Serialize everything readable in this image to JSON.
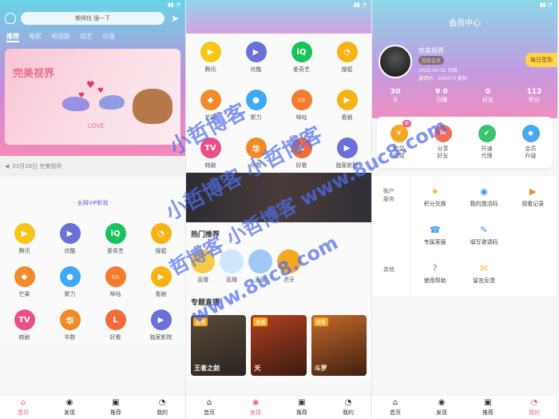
{
  "panel1": {
    "search_placeholder": "懒得找 搜一下",
    "tabs": [
      "推荐",
      "电影",
      "电视剧",
      "综艺",
      "动漫"
    ],
    "banner_title": "完美视界",
    "banner_love": "LOVE",
    "notice": "03月26日 完美视界",
    "vip_title": "· 全网VIP影视 ·",
    "grid": [
      {
        "label": "腾讯",
        "color": "#f5c518",
        "glyph": "▶"
      },
      {
        "label": "优酷",
        "color": "#6b6fd8",
        "glyph": "▶"
      },
      {
        "label": "爱奇艺",
        "color": "#19c35c",
        "glyph": "iQ"
      },
      {
        "label": "搜狐",
        "color": "#f5b316",
        "glyph": "◔"
      },
      {
        "label": "芒果",
        "color": "#f28b2b",
        "glyph": "◆"
      },
      {
        "label": "聚力",
        "color": "#3fa9f5",
        "glyph": "●"
      },
      {
        "label": "咪咕",
        "color": "#f57c2e",
        "glyph": "▭"
      },
      {
        "label": "看剧",
        "color": "#f5b316",
        "glyph": "▶"
      },
      {
        "label": "韩剧",
        "color": "#e94f8a",
        "glyph": "TV"
      },
      {
        "label": "华数",
        "color": "#f08a24",
        "glyph": "华"
      },
      {
        "label": "好看",
        "color": "#f26b3a",
        "glyph": "L"
      },
      {
        "label": "独家影院",
        "color": "#6b6fd8",
        "glyph": "▶"
      }
    ]
  },
  "panel2": {
    "grid": [
      {
        "label": "腾讯",
        "color": "#f5c518",
        "glyph": "▶"
      },
      {
        "label": "优酷",
        "color": "#6b6fd8",
        "glyph": "▶"
      },
      {
        "label": "爱奇艺",
        "color": "#19c35c",
        "glyph": "iQ"
      },
      {
        "label": "搜狐",
        "color": "#f5b316",
        "glyph": "◔"
      },
      {
        "label": "芒果",
        "color": "#f28b2b",
        "glyph": "◆"
      },
      {
        "label": "聚力",
        "color": "#3fa9f5",
        "glyph": "●"
      },
      {
        "label": "咪咕",
        "color": "#f57c2e",
        "glyph": "▭"
      },
      {
        "label": "看剧",
        "color": "#f5b316",
        "glyph": "▶"
      },
      {
        "label": "韩剧",
        "color": "#e94f8a",
        "glyph": "TV"
      },
      {
        "label": "华数",
        "color": "#f08a24",
        "glyph": "华"
      },
      {
        "label": "好看",
        "color": "#f26b3a",
        "glyph": "L"
      },
      {
        "label": "独家影院",
        "color": "#6b6fd8",
        "glyph": "▶"
      }
    ],
    "live_title": "热门推荐",
    "live_items": [
      "直播",
      "直播",
      "直播",
      "虎牙"
    ],
    "topic_title": "专题直播",
    "cards": [
      {
        "tag": "直播",
        "title": "王者之剑"
      },
      {
        "tag": "直播",
        "title": "天"
      },
      {
        "tag": "直播",
        "title": "斗罗"
      }
    ],
    "other": "其他"
  },
  "panel3": {
    "title": "会员中心",
    "username": "完美视界",
    "vip_badge": "超级会员",
    "meta_line1": "2020-04-02 到期",
    "meta_line2": "邀请码：309270 复制",
    "sign_button": "每日签到",
    "stats": [
      {
        "value": "30",
        "label": "天"
      },
      {
        "value": "¥ 0",
        "label": "已赚"
      },
      {
        "value": "0",
        "label": "好友"
      },
      {
        "value": "112",
        "label": "积分"
      }
    ],
    "new_tag": "新",
    "actions": [
      {
        "label": "收益\n提现",
        "color": "#f5a623",
        "glyph": "¥"
      },
      {
        "label": "分享\n好友",
        "color": "#f26b5a",
        "glyph": "✉"
      },
      {
        "label": "开通\n代理",
        "color": "#3cc46b",
        "glyph": "✔"
      },
      {
        "label": "会员\n升级",
        "color": "#4aa8f0",
        "glyph": "◆"
      }
    ],
    "menu_side": [
      "账户",
      "服务"
    ],
    "menu_items": [
      {
        "label": "积分兑换",
        "color": "#f5b316",
        "glyph": "★"
      },
      {
        "label": "我的激活码",
        "color": "#3a8ef0",
        "glyph": "◉"
      },
      {
        "label": "观看记录",
        "color": "#f28b2b",
        "glyph": "▶"
      },
      {
        "label": "专属客服",
        "color": "#3a8ef0",
        "glyph": "☎"
      },
      {
        "label": "填写邀请码",
        "color": "#3a8ef0",
        "glyph": "✎"
      },
      {
        "label": "",
        "color": "#ffffff",
        "glyph": ""
      },
      {
        "label": "使用帮助",
        "color": "#3a8ef0",
        "glyph": "?"
      },
      {
        "label": "留言反馈",
        "color": "#f5b316",
        "glyph": "✉"
      },
      {
        "label": "",
        "color": "#ffffff",
        "glyph": ""
      }
    ],
    "other_label": "其他"
  },
  "nav": [
    {
      "label": "首页",
      "glyph": "⌂"
    },
    {
      "label": "发现",
      "glyph": "◉"
    },
    {
      "label": "推荐",
      "glyph": "▣"
    },
    {
      "label": "我的",
      "glyph": "◔"
    }
  ],
  "watermark": {
    "line1": "小哲博客",
    "line2": "小哲博客 小哲博客",
    "line3": "哲博客 小哲博客 www.8uc8.com",
    "line4": "www.8uc8.com"
  }
}
